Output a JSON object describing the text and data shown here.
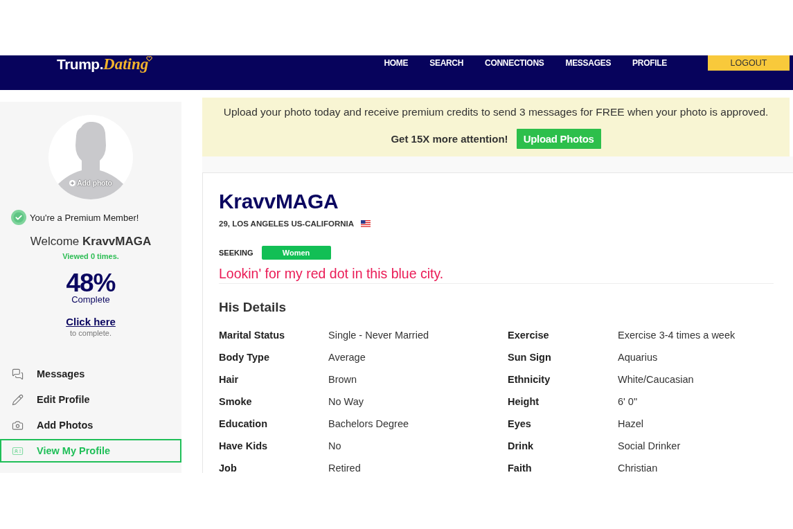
{
  "header": {
    "logo": {
      "text": "Trump.",
      "accent": "Dating"
    },
    "nav": [
      "HOME",
      "SEARCH",
      "CONNECTIONS",
      "MESSAGES",
      "PROFILE"
    ],
    "logout": "LOGOUT"
  },
  "sidebar": {
    "avatar": {
      "action": "Add photo"
    },
    "membership": "You're a Premium Member!",
    "welcome": "Welcome **KravvMAGA**",
    "views": "Viewed 0 times.",
    "completion": {
      "percent": "48%",
      "label": "Complete",
      "link": "Click here",
      "hint": "to complete."
    },
    "menu": [
      {
        "label": "Messages",
        "selected": false
      },
      {
        "label": "Edit Profile",
        "selected": false
      },
      {
        "label": "Add Photos",
        "selected": false
      },
      {
        "label": "View My Profile",
        "selected": true
      }
    ]
  },
  "banner": {
    "message": "Upload your photo today and receive premium credits to send 3 messages for FREE when your photo is approved.",
    "prompt": "Get 15X more attention!",
    "button": "Upload Photos"
  },
  "profile": {
    "username": "KravvMAGA",
    "location": "29, LOS ANGELES US-CALIFORNIA",
    "seeking": {
      "label": "SEEKING",
      "value": "Women"
    },
    "tagline": "Lookin' for my red dot in this blue city.",
    "details": {
      "title": "His Details",
      "fields": [
        {
          "label": "Marital Status",
          "value": "Single - Never Married"
        },
        {
          "label": "Exercise",
          "value": "Exercise 3-4 times a week"
        },
        {
          "label": "Body Type",
          "value": "Average"
        },
        {
          "label": "Sun Sign",
          "value": "Aquarius"
        },
        {
          "label": "Hair",
          "value": "Brown"
        },
        {
          "label": "Ethnicity",
          "value": "White/Caucasian"
        },
        {
          "label": "Smoke",
          "value": "No Way"
        },
        {
          "label": "Height",
          "value": "6' 0\""
        },
        {
          "label": "Education",
          "value": "Bachelors Degree"
        },
        {
          "label": "Eyes",
          "value": "Hazel"
        },
        {
          "label": "Have Kids",
          "value": "No"
        },
        {
          "label": "Drink",
          "value": "Social Drinker"
        },
        {
          "label": "Job",
          "value": "Retired"
        },
        {
          "label": "Faith",
          "value": "Christian"
        }
      ]
    }
  }
}
